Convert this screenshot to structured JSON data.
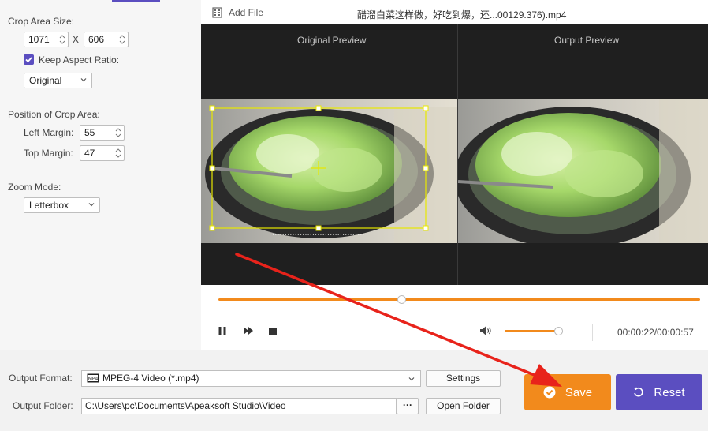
{
  "crop": {
    "area_size_label": "Crop Area Size:",
    "width": "1071",
    "x_sep": "X",
    "height": "606",
    "keep_aspect_label": "Keep Aspect Ratio:",
    "keep_aspect_checked": true,
    "aspect_value": "Original",
    "position_label": "Position of Crop Area:",
    "left_margin_label": "Left Margin:",
    "left_margin": "55",
    "top_margin_label": "Top Margin:",
    "top_margin": "47",
    "zoom_label": "Zoom Mode:",
    "zoom_value": "Letterbox"
  },
  "file": {
    "add_file_label": "Add File",
    "file_name": "醋溜白菜这样做，好吃到爆，还...00129.376).mp4"
  },
  "preview": {
    "original_title": "Original Preview",
    "output_title": "Output Preview"
  },
  "playback": {
    "progress": 0.38,
    "volume": 0.98,
    "time": "00:00:22/00:00:57"
  },
  "output": {
    "format_label": "Output Format:",
    "format_value": "MPEG-4 Video (*.mp4)",
    "settings_label": "Settings",
    "folder_label": "Output Folder:",
    "folder_value": "C:\\Users\\pc\\Documents\\Apeaksoft Studio\\Video",
    "browse_label": "···",
    "open_folder_label": "Open Folder",
    "save_label": "Save",
    "reset_label": "Reset"
  },
  "colors": {
    "accent_orange": "#f28a1c",
    "accent_purple": "#5b4ec0",
    "crop_box": "#e8e800",
    "annotation_arrow": "#e8231b"
  }
}
